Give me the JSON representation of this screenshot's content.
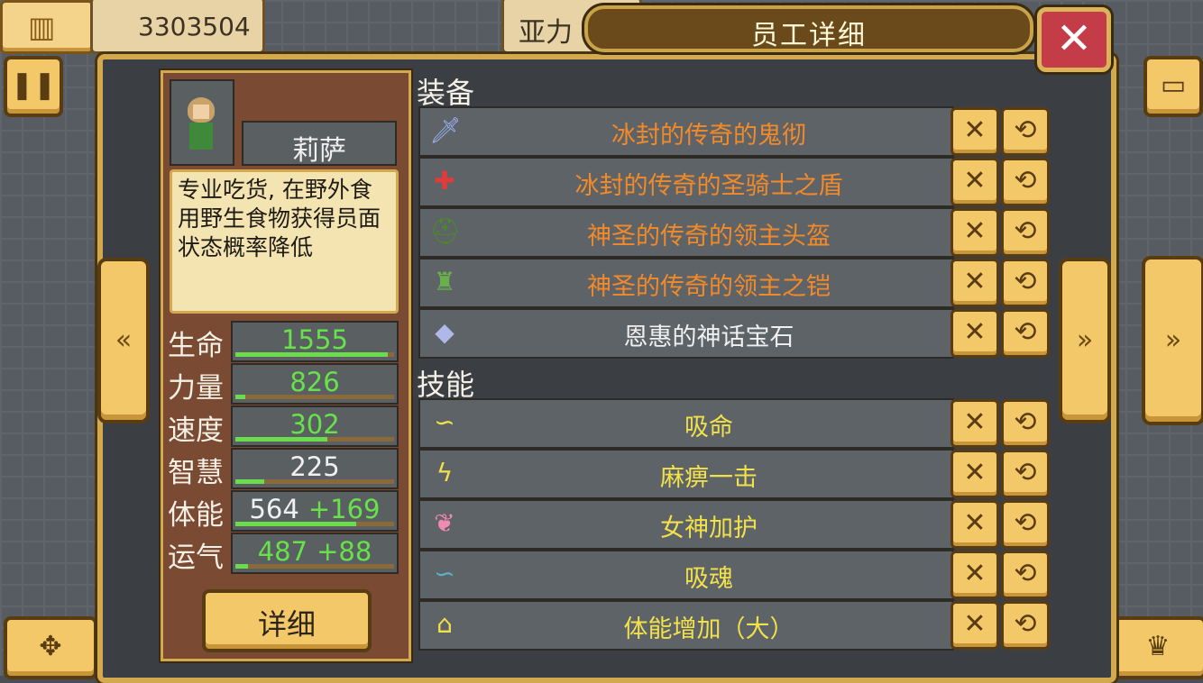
{
  "hud": {
    "money": "3303504",
    "location_partial": "亚力"
  },
  "window": {
    "title": "员工详细",
    "close_icon": "✕"
  },
  "character": {
    "name": "莉萨",
    "description": "专业吃货, 在野外食用野生食物获得员面状态概率降低",
    "stats": [
      {
        "label": "生命",
        "value": "1555",
        "bonus": "",
        "color": "green",
        "fill": 0.96
      },
      {
        "label": "力量",
        "value": "826",
        "bonus": "",
        "color": "green",
        "fill": 0.06
      },
      {
        "label": "速度",
        "value": "302",
        "bonus": "",
        "color": "green",
        "fill": 0.58
      },
      {
        "label": "智慧",
        "value": "225",
        "bonus": "",
        "color": "white",
        "fill": 0.18
      },
      {
        "label": "体能",
        "value": "564",
        "bonus": "+169",
        "color": "white",
        "fill": 0.76
      },
      {
        "label": "运气",
        "value": "487",
        "bonus": "+88",
        "color": "green",
        "fill": 0.08
      }
    ],
    "detail_button": "详细"
  },
  "equipment": {
    "title": "装备",
    "items": [
      {
        "name": "冰封的传奇的鬼彻",
        "color": "orange",
        "icon": "sword-icon"
      },
      {
        "name": "冰封的传奇的圣骑士之盾",
        "color": "orange",
        "icon": "shield-icon"
      },
      {
        "name": "神圣的传奇的领主头盔",
        "color": "orange",
        "icon": "helmet-icon"
      },
      {
        "name": "神圣的传奇的领主之铠",
        "color": "orange",
        "icon": "armor-icon"
      },
      {
        "name": "恩惠的神话宝石",
        "color": "white",
        "icon": "gem-icon"
      }
    ]
  },
  "skills": {
    "title": "技能",
    "items": [
      {
        "name": "吸命",
        "icon": "drain-life-icon"
      },
      {
        "name": "麻痹一击",
        "icon": "lightning-icon"
      },
      {
        "name": "女神加护",
        "icon": "wing-icon"
      },
      {
        "name": "吸魂",
        "icon": "drain-soul-icon"
      },
      {
        "name": "体能增加（大）",
        "icon": "shirt-icon"
      }
    ]
  },
  "colors": {
    "orange": "#f28a2a",
    "yellow": "#f2e14a",
    "green": "#68e24a",
    "white": "#f0f0f0",
    "gold": "#f3c868"
  }
}
